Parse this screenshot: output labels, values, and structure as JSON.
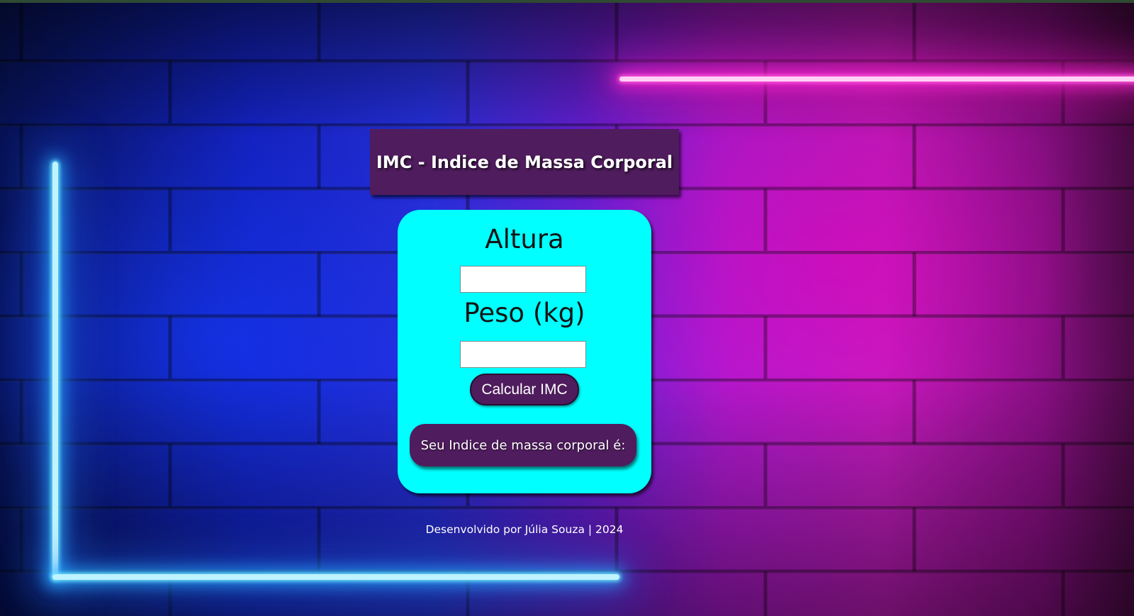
{
  "header": {
    "title": "IMC - Indice de Massa Corporal"
  },
  "form": {
    "height_label": "Altura",
    "height_value": "",
    "weight_label": "Peso (kg)",
    "weight_value": "",
    "calculate_button_label": "Calcular IMC"
  },
  "result": {
    "text": "Seu Indice de massa corporal é:"
  },
  "footer": {
    "text": "Desenvolvido por Júlia Souza | 2024"
  },
  "colors": {
    "panel_purple": "#4f1c5d",
    "card_cyan": "#00ffff",
    "neon_blue": "#6fe6ff",
    "neon_pink": "#ff5ae0"
  }
}
